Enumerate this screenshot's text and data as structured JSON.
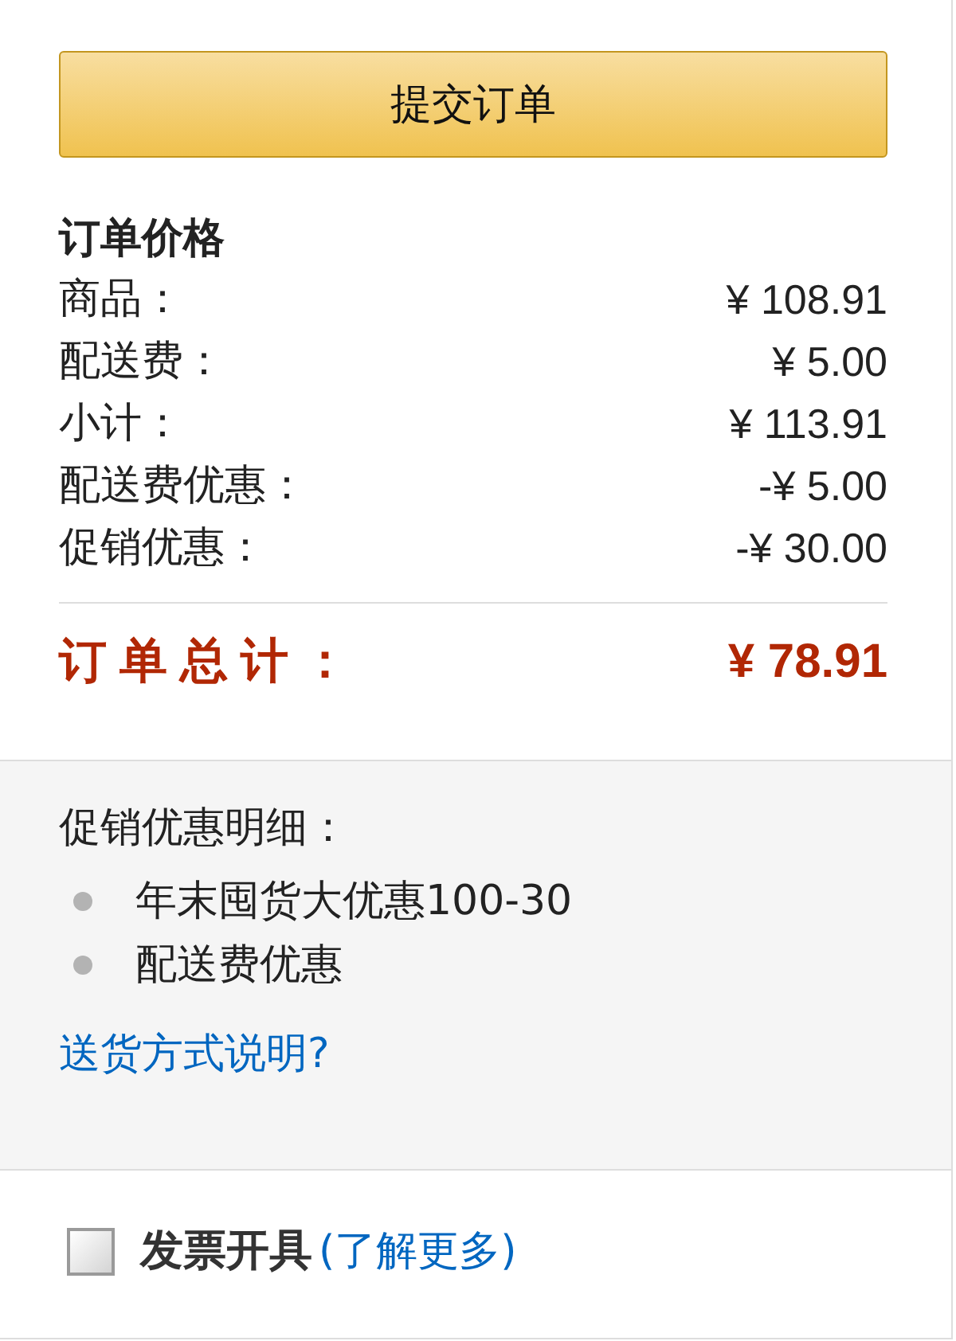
{
  "submit_button": {
    "label": "提交订单"
  },
  "order_price": {
    "title": "订单价格",
    "rows": [
      {
        "label": "商品：",
        "price": "¥ 108.91"
      },
      {
        "label": "配送费：",
        "price": "¥ 5.00"
      },
      {
        "label": "小计：",
        "price": "¥ 113.91"
      },
      {
        "label": "配送费优惠：",
        "price": "-¥ 5.00"
      },
      {
        "label": "促销优惠：",
        "price": "-¥ 30.00"
      }
    ],
    "total": {
      "label": "订单总计：",
      "price": "¥ 78.91"
    }
  },
  "promotions": {
    "title": "促销优惠明细：",
    "items": [
      "年末囤货大优惠100-30",
      "配送费优惠"
    ],
    "link": "送货方式说明?"
  },
  "invoice": {
    "checked": false,
    "label": "发票开具",
    "link": "(了解更多)"
  }
}
